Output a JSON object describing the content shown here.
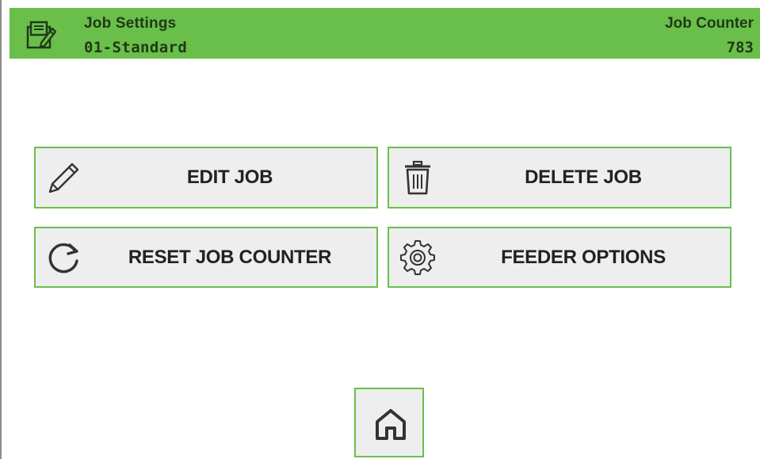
{
  "header": {
    "title": "Job Settings",
    "job_name": "01-Standard",
    "counter_label": "Job Counter",
    "counter_value": "783",
    "icon": "job-settings-icon",
    "background_color": "#6abf4b"
  },
  "buttons": {
    "edit_job": {
      "label": "EDIT JOB",
      "icon": "pencil-icon"
    },
    "delete_job": {
      "label": "DELETE JOB",
      "icon": "trash-icon"
    },
    "reset_job_counter": {
      "label": "RESET JOB COUNTER",
      "icon": "refresh-icon"
    },
    "feeder_options": {
      "label": "FEEDER OPTIONS",
      "icon": "gear-icon"
    }
  },
  "footer": {
    "home_icon": "home-icon"
  },
  "colors": {
    "accent": "#6abf4b",
    "button_bg": "#eeeeee",
    "text": "#222222"
  }
}
